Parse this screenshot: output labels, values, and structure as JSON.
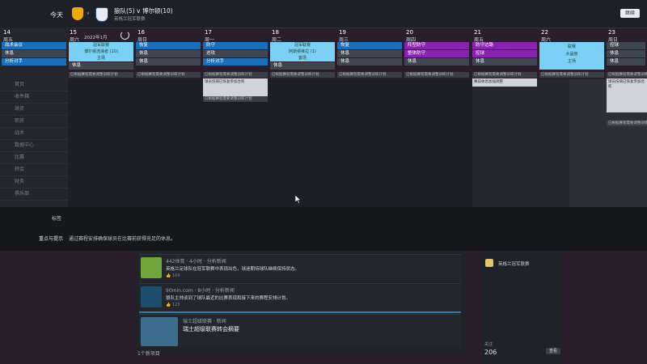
{
  "header": {
    "today": "今天",
    "match_title": "狼队(5) v 博尔顿(10)",
    "match_sub": "英格兰冠军联赛",
    "button": "继续"
  },
  "calendar": {
    "month": "2022年1月",
    "days": [
      {
        "num": "14",
        "wd": "周五"
      },
      {
        "num": "15",
        "wd": "周六"
      },
      {
        "num": "16",
        "wd": "周日"
      },
      {
        "num": "17",
        "wd": "周一"
      },
      {
        "num": "18",
        "wd": "周二"
      },
      {
        "num": "19",
        "wd": "周三"
      },
      {
        "num": "20",
        "wd": "周四"
      },
      {
        "num": "21",
        "wd": "周五"
      },
      {
        "num": "22",
        "wd": "周六"
      },
      {
        "num": "23",
        "wd": "周日"
      }
    ],
    "d14": {
      "a": "战术会议",
      "b": "休息",
      "c": "分析对手"
    },
    "d15": {
      "card_top": "冠军联赛",
      "card_mid": "博尔顿流浪者 (10)",
      "card_bot": "主场",
      "c": "休息"
    },
    "d16": {
      "a": "恢复",
      "b": "休息",
      "c": "休息"
    },
    "d17": {
      "a": "防守",
      "b": "进攻",
      "c": "分析对手"
    },
    "d18": {
      "card_top": "冠军联赛",
      "card_mid": "阿斯顿维拉 (1)",
      "card_bot": "客场",
      "c": "休息"
    },
    "d19": {
      "a": "恢复",
      "b": "休息",
      "c": "休息"
    },
    "d20": {
      "a": "阵型防守",
      "b": "整体防守",
      "c": "休息"
    },
    "d21": {
      "a": "防守边路",
      "b": "控球",
      "c": "休息"
    },
    "d22": {
      "card_top": "联赛",
      "card_mid": "水晶宫",
      "card_bot": "主场"
    },
    "d23": {
      "a": "控球",
      "b": "休息",
      "c": "休息"
    },
    "infoline": "已根据赛程需要调整训练计划",
    "popup17": "球员伤病已恢复参加合练",
    "popup21": "赛前休息加强调整"
  },
  "sidebar": {
    "items": [
      "首页",
      "收件箱",
      "球员",
      "职员",
      "战术",
      "数据中心",
      "比赛",
      "转会",
      "财务",
      "俱乐部"
    ]
  },
  "strip": {
    "label1": "标签",
    "label2": "重点与提示",
    "text": "通过赛程安排确保球员在比赛前获得充足的休息。"
  },
  "feed": {
    "posts": [
      {
        "src": "442体育 · 4小时 · 分析新闻",
        "txt": "英格兰足球队在冠军联赛中表现出色，球迷期待球队继续保持状态。",
        "like": "164"
      },
      {
        "src": "90min.com · 8小时 · 分析新闻",
        "txt": "狼队主帅谈到了球队最近的比赛表现和接下来的赛程安排计划。",
        "like": "123"
      },
      {
        "src": "瑞士超级联赛 · 新闻",
        "txt": "瑞士超级联赛转会摘要",
        "like": ""
      }
    ],
    "footer": "1个新项目"
  },
  "right_list": {
    "count_label": "关注",
    "count": "206",
    "button": "查看",
    "last_item": "英格兰冠军联赛"
  },
  "colors": {
    "accent_blue": "#1a6fb8",
    "purple": "#8a22b0",
    "card": "#7bd0f5",
    "bg": "#2a1e2c"
  }
}
